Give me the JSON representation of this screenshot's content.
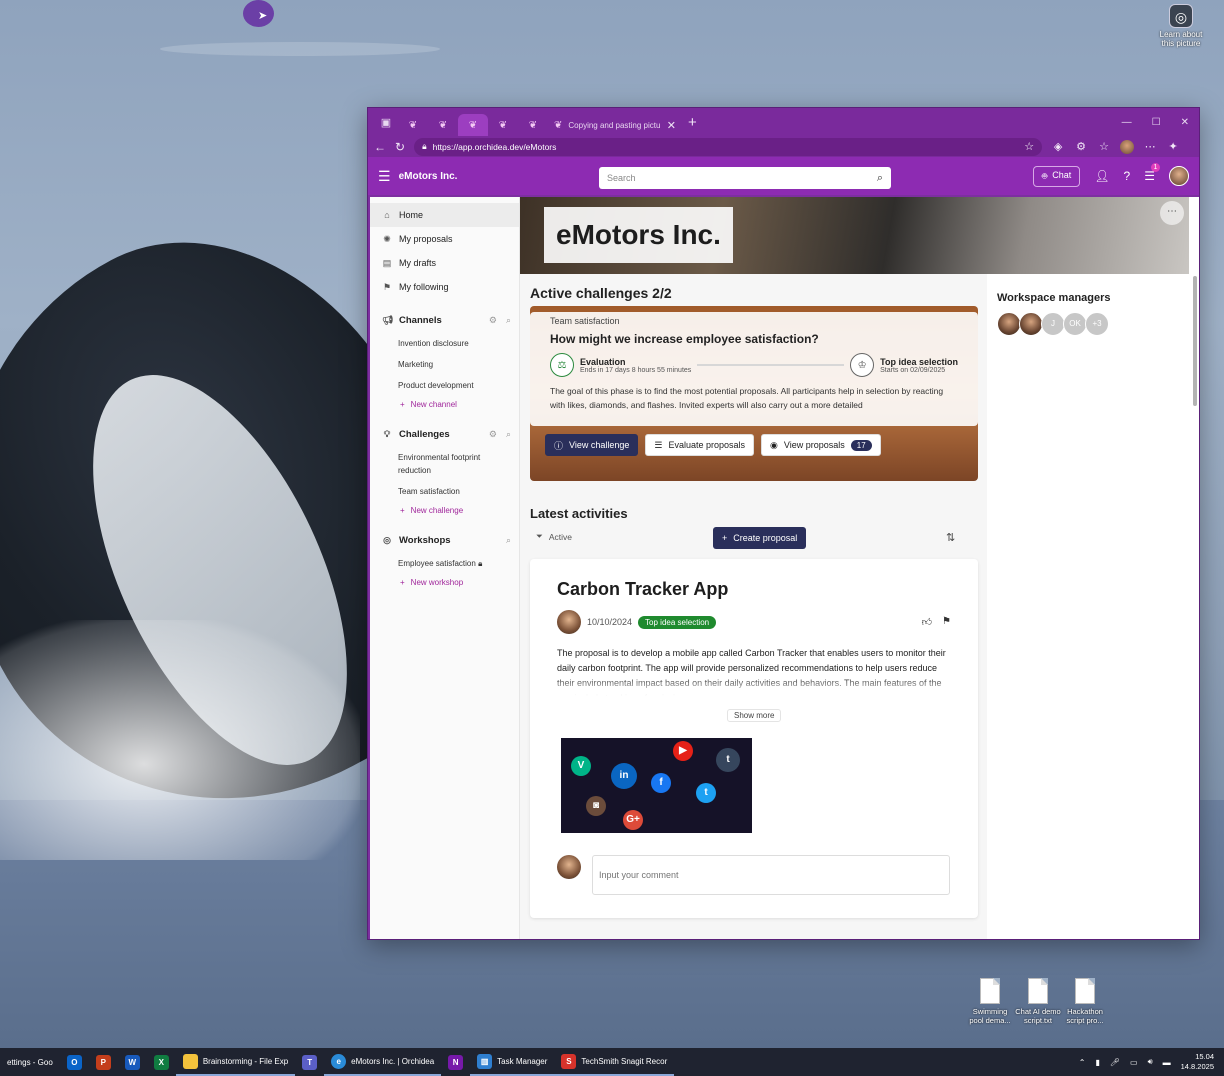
{
  "desktop": {
    "learn_label": "Learn about this picture",
    "files": [
      {
        "label": "Swimming pool dema..."
      },
      {
        "label": "Chat AI demo script.txt"
      },
      {
        "label": "Hackathon script pro..."
      }
    ]
  },
  "browser": {
    "active_tab_title": "Copying and pasting pictures to",
    "url": "https://app.orchidea.dev/eMotors"
  },
  "app": {
    "brand": "eMotors Inc.",
    "search_placeholder": "Search",
    "chat_label": "Chat",
    "notifications_count": "1"
  },
  "sidebar": {
    "items": [
      {
        "label": "Home",
        "icon": "home-icon"
      },
      {
        "label": "My proposals",
        "icon": "lightbulb-icon"
      },
      {
        "label": "My drafts",
        "icon": "document-icon"
      },
      {
        "label": "My following",
        "icon": "bookmark-icon"
      }
    ],
    "channels": {
      "title": "Channels",
      "items": [
        "Invention disclosure",
        "Marketing",
        "Product development"
      ],
      "new_label": "New channel"
    },
    "challenges": {
      "title": "Challenges",
      "items": [
        "Environmental footprint reduction",
        "Team satisfaction"
      ],
      "new_label": "New challenge"
    },
    "workshops": {
      "title": "Workshops",
      "items": [
        "Employee satisfaction"
      ],
      "new_label": "New workshop"
    }
  },
  "hero": {
    "title": "eMotors Inc."
  },
  "active_challenges": {
    "heading": "Active challenges 2/2",
    "card": {
      "tag": "Team satisfaction",
      "question": "How might we increase employee satisfaction?",
      "phase_current": {
        "name": "Evaluation",
        "sub": "Ends in 17 days 8 hours 55 minutes"
      },
      "phase_next": {
        "name": "Top idea selection",
        "sub": "Starts on 02/09/2025"
      },
      "description": "The goal of this phase is to find the most potential proposals. All participants help in selection by reacting with likes, diamonds, and flashes. Invited experts will also carry out a more detailed",
      "btn_view": "View challenge",
      "btn_evaluate": "Evaluate proposals",
      "btn_proposals": "View proposals",
      "proposals_count": "17"
    }
  },
  "latest": {
    "heading": "Latest activities",
    "filter": "Active",
    "create_label": "Create proposal",
    "proposal": {
      "title": "Carbon Tracker App",
      "date": "10/10/2024",
      "stage": "Top idea selection",
      "body": "The proposal is to develop a mobile app called Carbon Tracker that enables users to monitor their daily carbon footprint. The app will provide personalized recommendations to help users reduce their environmental impact based on their daily activities and behaviors. The main features of the app include tracking of emissions across",
      "show_more": "Show more",
      "comment_placeholder": "Input your comment"
    }
  },
  "workspace": {
    "title": "Workspace managers",
    "letters": [
      "J",
      "OK",
      "+3"
    ]
  },
  "taskbar": {
    "apps": [
      {
        "label": "ettings - Goo",
        "color": "#444"
      },
      {
        "label": "",
        "color": "#0a64c8",
        "glyph": "O"
      },
      {
        "label": "",
        "color": "#c43e1c",
        "glyph": "P"
      },
      {
        "label": "",
        "color": "#185abd",
        "glyph": "W"
      },
      {
        "label": "",
        "color": "#107c41",
        "glyph": "X"
      },
      {
        "label": "Brainstorming - File Exp",
        "color": "#f3c23c",
        "glyph": ""
      },
      {
        "label": "",
        "color": "#5b5fc7",
        "glyph": "T"
      },
      {
        "label": "eMotors Inc. | Orchidea",
        "color": "#2a8bd8",
        "glyph": "e"
      },
      {
        "label": "",
        "color": "#7719aa",
        "glyph": "N"
      },
      {
        "label": "Task Manager",
        "color": "#2f7fd0",
        "glyph": "▥"
      },
      {
        "label": "TechSmith Snagit Recor",
        "color": "#d6332b",
        "glyph": "S"
      }
    ],
    "time": "15.04",
    "date": "14.8.2025"
  },
  "colors": {
    "brand": "#8d2bb2",
    "primary_button": "#2a2f5b",
    "stage_green": "#1f8a2e"
  }
}
